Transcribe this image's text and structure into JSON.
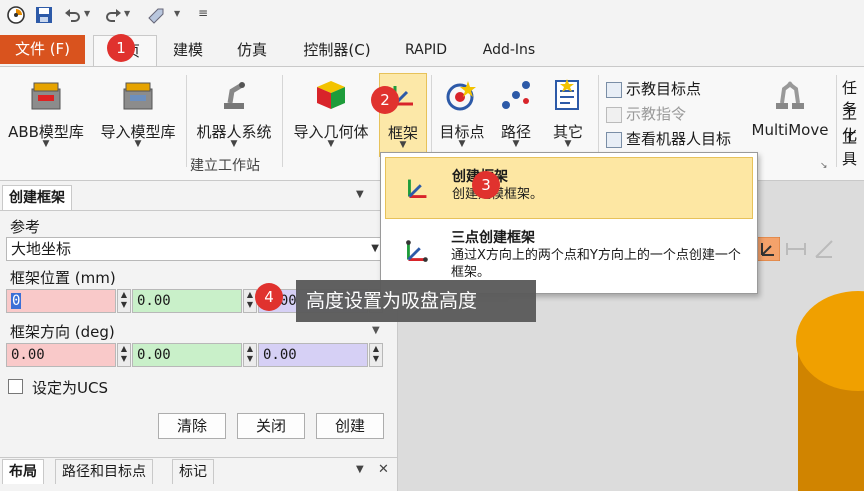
{
  "quick_access": {
    "icons": [
      "app-logo-icon",
      "save-icon",
      "undo-icon",
      "redo-icon",
      "tag-icon",
      "customize-icon"
    ]
  },
  "tabs": {
    "file": "文件 (F)",
    "home": "主页",
    "modeling": "建模",
    "simulation": "仿真",
    "controller": "控制器(C)",
    "rapid": "RAPID",
    "addins": "Add-Ins"
  },
  "ribbon": {
    "abb_library": "ABB模型库",
    "import_library": "导入模型库",
    "robot_system": "机器人系统",
    "import_geometry": "导入几何体",
    "frame": "框架",
    "target": "目标点",
    "path": "路径",
    "other": "其它",
    "teach_target": "示教目标点",
    "teach_instruction": "示教指令",
    "view_robot_target": "查看机器人目标",
    "multimove": "MultiMove",
    "task_partial": "任务",
    "work_partial1": "工化",
    "work_partial2": "工具",
    "group_label": "建立工作站"
  },
  "menu": {
    "create_frame_title": "创建框架",
    "create_frame_desc": "创建建模框架。",
    "three_point_title": "三点创建框架",
    "three_point_desc": "通过X方向上的两个点和Y方向上的一个点创建一个框架。"
  },
  "panel": {
    "tab_title": "创建框架",
    "reference_label": "参考",
    "reference_value": "大地坐标",
    "position_label": "框架位置 (mm)",
    "pos_x": "0",
    "pos_y": "0.00",
    "pos_z": "0.00",
    "orientation_label": "框架方向 (deg)",
    "rot_x": "0.00",
    "rot_y": "0.00",
    "rot_z": "0.00",
    "set_ucs_label": "设定为UCS",
    "clear_button": "清除",
    "close_button": "关闭",
    "create_button": "创建",
    "bottom_tabs": [
      "布局",
      "路径和目标点",
      "标记"
    ]
  },
  "annotations": {
    "badge1": "1",
    "badge2": "2",
    "badge3": "3",
    "badge4": "4",
    "tooltip": "高度设置为吸盘高度"
  },
  "colors": {
    "file_tab": "#d9531e",
    "badge": "#e0322e",
    "menu_highlight": "#fde7a3",
    "x_field": "#f9c9c9",
    "y_field": "#c9f0c9",
    "z_field": "#d6d0f5",
    "cylinder": "#f0a000"
  }
}
